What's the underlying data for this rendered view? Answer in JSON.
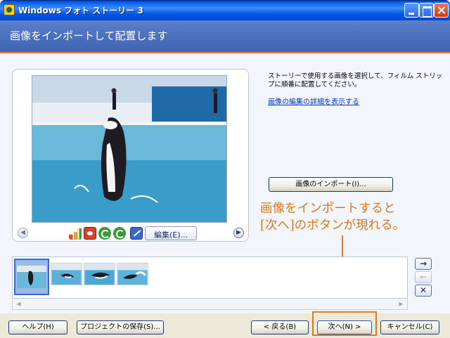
{
  "window": {
    "title": "Windows フォト ストーリー 3"
  },
  "header": {
    "title": "画像をインポートして配置します"
  },
  "preview": {
    "edit_label": "編集(E)..."
  },
  "description": {
    "text": "ストーリーで使用する画像を選択して、フィルム ストリップに順番に配置してください。",
    "details_link": "画像の編集の詳細を表示する"
  },
  "import_button": "画像のインポート(I)...",
  "annotation": {
    "line1": "画像をインポートすると",
    "line2": "[次へ]のボタンが現れる。"
  },
  "filmstrip": {
    "thumb_count": 4,
    "selected_index": 0
  },
  "side_buttons": {
    "right": "→",
    "left": "←",
    "remove": "✕"
  },
  "bottom": {
    "help": "ヘルプ(H)",
    "save_project": "プロジェクトの保存(S)...",
    "back": "< 戻る(B)",
    "next": "次へ(N) >",
    "cancel": "キャンセル(C)"
  },
  "icons": {
    "preview": [
      "chart-icon",
      "red-eye-icon",
      "rotate-left-icon",
      "rotate-right-icon",
      "edit-icon"
    ],
    "nav": [
      "arrow-left-icon",
      "arrow-right-icon"
    ]
  },
  "colors": {
    "accent": "#E07818",
    "header": "#3E64B4",
    "link": "#0033CC"
  }
}
